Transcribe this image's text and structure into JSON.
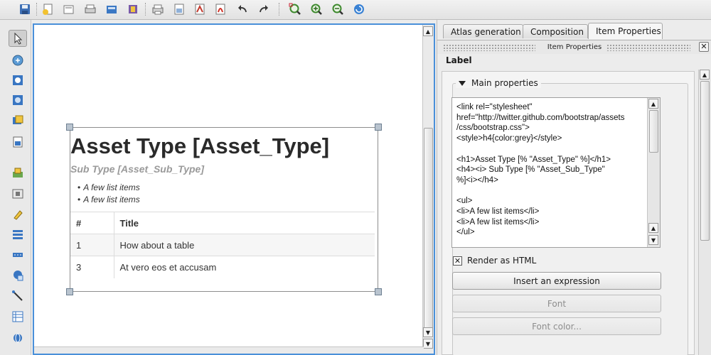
{
  "toolbar": {
    "buttons": [
      "save-icon",
      "new-composer-icon",
      "duplicate-composer-icon",
      "page-setup-icon",
      "composer-manager-icon",
      "load-template-icon",
      "print-icon",
      "export-image-icon",
      "export-svg-icon",
      "export-pdf-icon",
      "undo-icon",
      "redo-icon",
      "zoom-full-icon",
      "zoom-in-icon",
      "zoom-out-icon",
      "refresh-icon"
    ]
  },
  "left_tools": [
    "select-move-icon",
    "pan-icon",
    "zoom-tool-icon",
    "move-content-icon",
    "add-map-icon",
    "add-image-icon",
    "add-label-icon",
    "add-legend-icon",
    "add-scalebar-icon",
    "add-shape-icon",
    "add-arrow-icon",
    "add-table-icon",
    "add-html-icon"
  ],
  "canvas": {
    "label": {
      "heading": "Asset Type [Asset_Type]",
      "subheading": "Sub Type [Asset_Sub_Type]",
      "bullets": [
        "A few list items",
        "A few list items"
      ],
      "table": {
        "headers": [
          "#",
          "Title"
        ],
        "rows": [
          [
            "1",
            "How about a table"
          ],
          [
            "3",
            "At vero eos et accusam"
          ]
        ]
      }
    }
  },
  "panel": {
    "tabs": [
      "Atlas generation",
      "Composition",
      "Item Properties"
    ],
    "active_tab": "Item Properties",
    "dock_title": "Item Properties",
    "section_title": "Label",
    "group_title": "Main properties",
    "editor_text": "<link rel=\"stylesheet\"\nhref=\"http://twitter.github.com/bootstrap/assets\n/css/bootstrap.css\">\n<style>h4{color:grey}</style>\n\n<h1>Asset Type [% \"Asset_Type\" %]</h1>\n<h4><i> Sub Type [% \"Asset_Sub_Type\"\n%]<i></h4>\n\n<ul>\n<li>A few list items</li>\n<li>A few list items</li>\n</ul>",
    "render_html_label": "Render as HTML",
    "render_html_checked": true,
    "insert_expression_label": "Insert an expression",
    "font_label": "Font",
    "font_color_label": "Font color..."
  }
}
